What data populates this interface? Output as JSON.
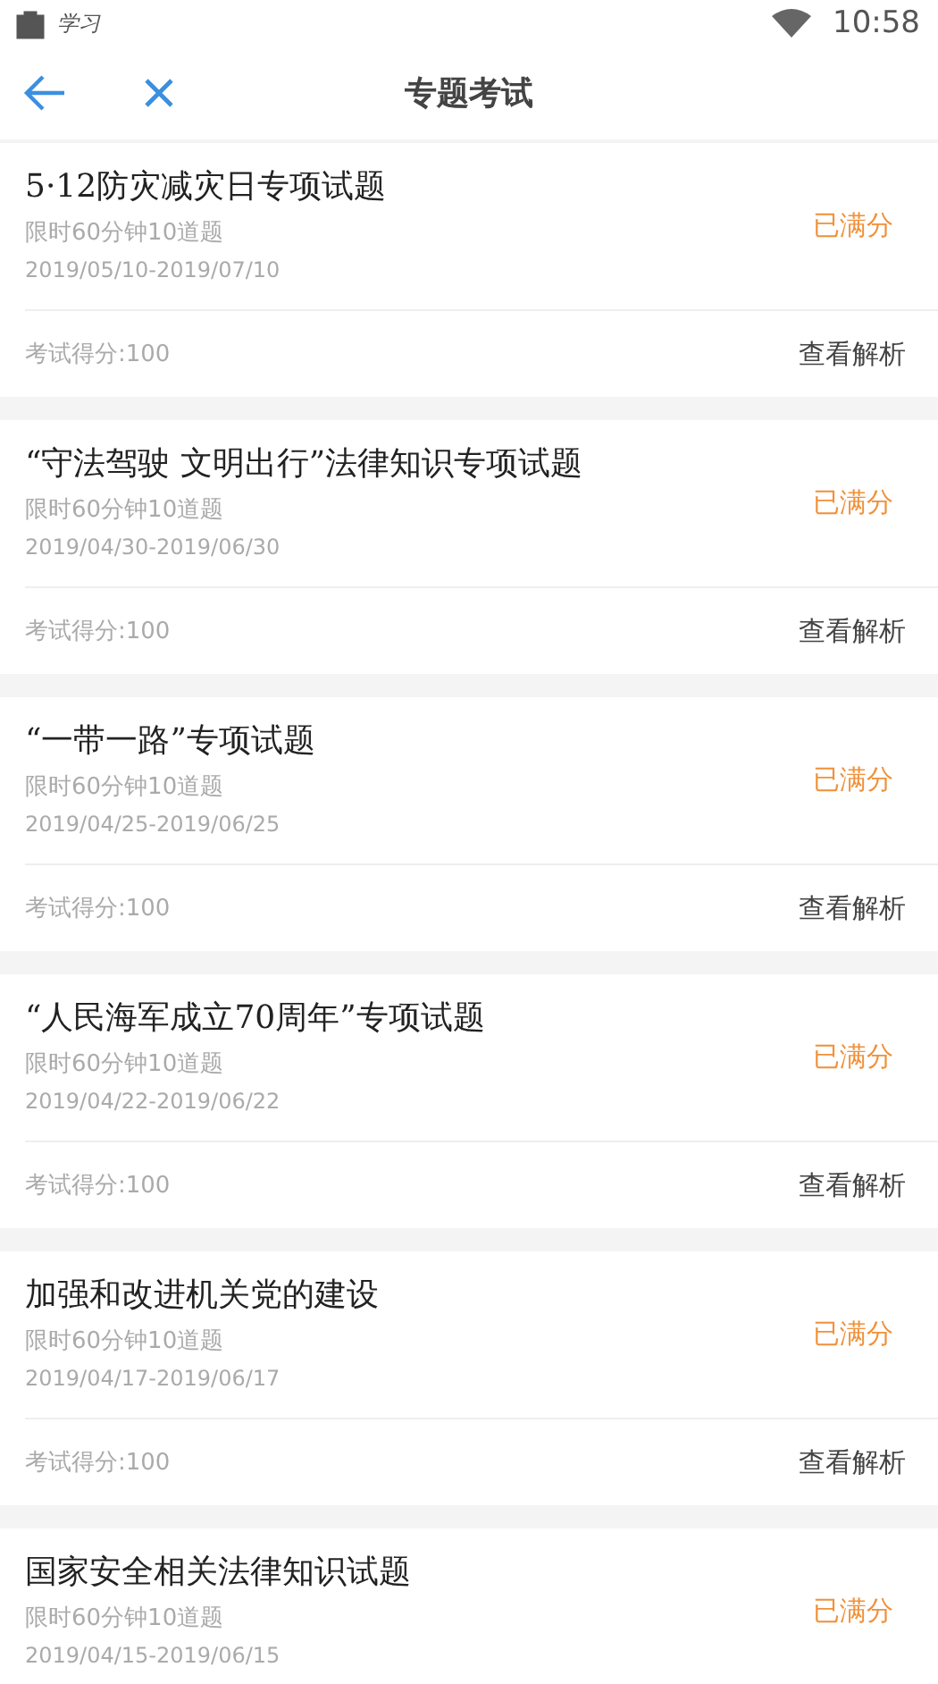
{
  "status_bar": {
    "app_label": "学习",
    "time": "10:58"
  },
  "header": {
    "title": "专题考试"
  },
  "exams": [
    {
      "title": "5·12防灾减灾日专项试题",
      "limit": "限时60分钟10道题",
      "period": "2019/05/10-2019/07/10",
      "status": "已满分",
      "score": "考试得分:100",
      "action": "查看解析"
    },
    {
      "title": "“守法驾驶 文明出行”法律知识专项试题",
      "limit": "限时60分钟10道题",
      "period": "2019/04/30-2019/06/30",
      "status": "已满分",
      "score": "考试得分:100",
      "action": "查看解析"
    },
    {
      "title": "“一带一路”专项试题",
      "limit": "限时60分钟10道题",
      "period": "2019/04/25-2019/06/25",
      "status": "已满分",
      "score": "考试得分:100",
      "action": "查看解析"
    },
    {
      "title": "“人民海军成立70周年”专项试题",
      "limit": "限时60分钟10道题",
      "period": "2019/04/22-2019/06/22",
      "status": "已满分",
      "score": "考试得分:100",
      "action": "查看解析"
    },
    {
      "title": "加强和改进机关党的建设",
      "limit": "限时60分钟10道题",
      "period": "2019/04/17-2019/06/17",
      "status": "已满分",
      "score": "考试得分:100",
      "action": "查看解析"
    },
    {
      "title": "国家安全相关法律知识试题",
      "limit": "限时60分钟10道题",
      "period": "2019/04/15-2019/06/15",
      "status": "已满分"
    }
  ]
}
